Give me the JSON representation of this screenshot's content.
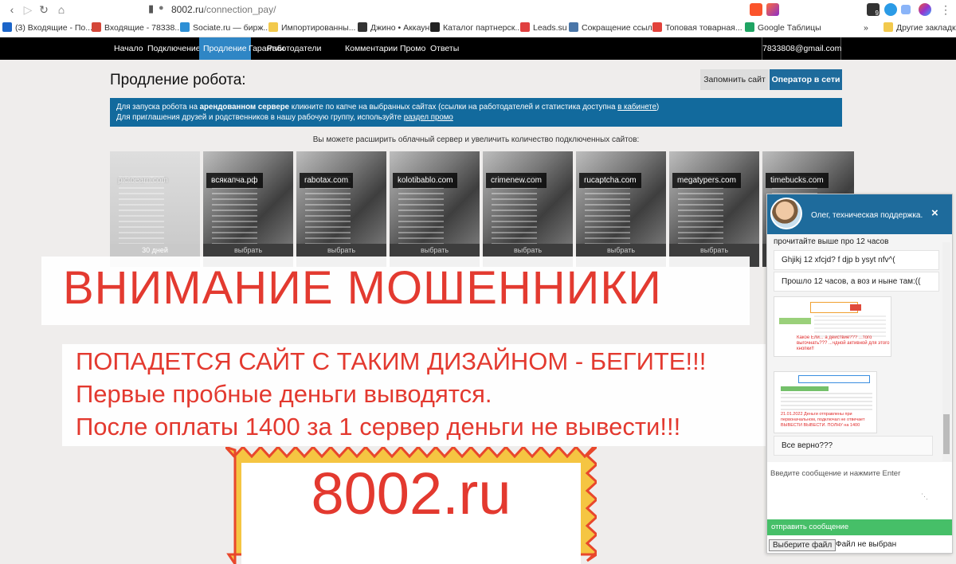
{
  "browser": {
    "url_host": "8002.ru",
    "url_path": "/connection_pay/",
    "ext_badge": "9",
    "bookmarks": [
      {
        "label": "(3) Входящие - По...",
        "icon": "mail-icon",
        "color": "#1b65c9"
      },
      {
        "label": "Входящие - 78338...",
        "icon": "gmail-icon",
        "color": "#d44638"
      },
      {
        "label": "Sociate.ru — бирж...",
        "icon": "sociate-icon",
        "color": "#2d8fd5"
      },
      {
        "label": "Импортированны...",
        "icon": "folder-icon",
        "color": "#f2c94c"
      },
      {
        "label": "Джино • Аккаунт",
        "icon": "jino-icon",
        "color": "#333333"
      },
      {
        "label": "Каталог партнерск...",
        "icon": "ap-icon",
        "color": "#222222"
      },
      {
        "label": "Leads.su",
        "icon": "leads-icon",
        "color": "#e04040"
      },
      {
        "label": "Сокращение ссылок",
        "icon": "vk-icon",
        "color": "#4a76a8"
      },
      {
        "label": "Топовая товарная...",
        "icon": "mi-icon",
        "color": "#e2413a"
      },
      {
        "label": "Google Таблицы",
        "icon": "sheets-icon",
        "color": "#1fa463"
      },
      {
        "label": "»",
        "icon": "",
        "color": ""
      },
      {
        "label": "Другие закладки",
        "icon": "folder-icon",
        "color": "#f2c94c"
      }
    ]
  },
  "nav": {
    "items": [
      "Начало",
      "Подключение",
      "Продление",
      "Гарантии",
      "Работодатели",
      "Комментарии",
      "Промо",
      "Ответы"
    ],
    "email": "7833808@gmail.com"
  },
  "page": {
    "title": "Продление робота:",
    "remember_btn": "Запомнить сайт",
    "operator_btn": "Оператор в сети",
    "info": {
      "l1_a": "Для запуска робота на ",
      "l1_b": "арендованном сервере",
      "l1_c": " кликните по капче на выбранных сайтах (ссылки на работодателей и статистика доступна ",
      "l1_link": "в кабинете",
      "l1_d": ")",
      "l2_a": "Для приглашения друзей и родственников в нашу рабочую группу, используйте ",
      "l2_link": "раздел промо"
    },
    "subtitle": "Вы можете расширить облачный сервер и увеличить количество подключенных сайтов:",
    "sites": [
      {
        "name": "pictoearn.com",
        "btn": "30 дней"
      },
      {
        "name": "всякапча.рф",
        "btn": "выбрать"
      },
      {
        "name": "rabotax.com",
        "btn": "выбрать"
      },
      {
        "name": "kolotibablo.com",
        "btn": "выбрать"
      },
      {
        "name": "crimenew.com",
        "btn": "выбрать"
      },
      {
        "name": "rucaptcha.com",
        "btn": "выбрать"
      },
      {
        "name": "megatypers.com",
        "btn": "выбрать"
      },
      {
        "name": "timebucks.com",
        "btn": "выбрать"
      }
    ]
  },
  "overlay": {
    "headline": "ВНИМАНИЕ МОШЕННИКИ",
    "line1": "ПОПАДЕТСЯ САЙТ С ТАКИМ ДИЗАЙНОМ - БЕГИТЕ!!!",
    "line2": "Первые пробные деньги выводятся.",
    "line3": "После оплаты 1400 за 1 сервер деньги не вывести!!!",
    "stamp": "8002.ru"
  },
  "chat": {
    "agent": "Олег, техническая поддержка.",
    "close": "×",
    "messages": [
      "прочитайте выше про 12 часов",
      "Ghjikj 12 xfcjd? f djp b ysyt nfv^(",
      "Прошло 12 часов, а воз и ныне там:((",
      "Все верно???"
    ],
    "thumb1_text": "Какое Ели... а действие??? ...того выгочнать??? ...чдной активной для этого кнопки!!",
    "thumb2_text": "21.01.2022 Деньги отправлены при первоначальном, подключал не отвечает ВЫВЕСТИ ВЫВЕСТИ. ПОЛНУ на 1400",
    "input_placeholder": "Введите сообщение и нажмите Enter",
    "send": "отправить сообщение",
    "file_btn": "Выберите файл",
    "file_status": "Файл не выбран"
  }
}
